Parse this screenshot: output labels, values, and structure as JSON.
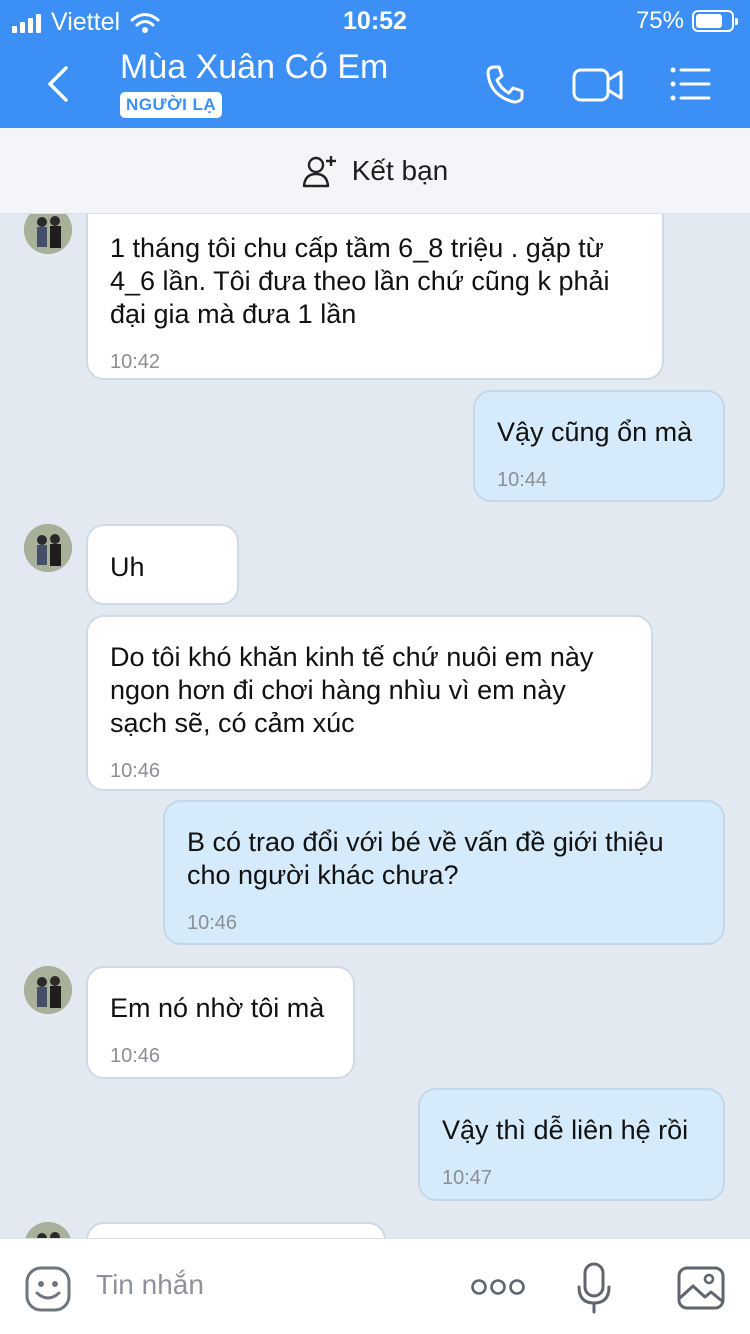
{
  "status_bar": {
    "carrier": "Viettel",
    "time": "10:52",
    "battery": "75%",
    "battery_level": 0.75
  },
  "header": {
    "title": "Mùa Xuân Có Em",
    "badge": "NGƯỜI LẠ",
    "icons": [
      "back-icon",
      "phone-icon",
      "video-call-icon",
      "menu-icon"
    ],
    "accent_color": "#3b8ff5"
  },
  "friend_bar": {
    "label": "Kết bạn",
    "icon": "add-user-icon"
  },
  "messages": [
    {
      "side": "in",
      "text": "1 tháng tôi chu cấp tầm 6_8 triệu . gặp từ\n4_6 lần. Tôi đưa theo lần chứ cũng k phải\nđại gia mà đưa 1 lần",
      "time": "10:42"
    },
    {
      "side": "out",
      "text": "Vậy cũng ổn mà",
      "time": "10:44"
    },
    {
      "side": "in",
      "text": "Uh",
      "time": ""
    },
    {
      "side": "in",
      "text": "Do tôi khó khăn kinh tế chứ nuôi em này\nngon hơn đi chơi hàng nhìu vì em này\nsạch sẽ, có cảm xúc",
      "time": "10:46"
    },
    {
      "side": "out",
      "text": "B có trao đổi với bé về vấn đề giới thiệu\ncho người khác chưa?",
      "time": "10:46"
    },
    {
      "side": "in",
      "text": "Em nó nhờ tôi mà",
      "time": "10:46"
    },
    {
      "side": "out",
      "text": "Vậy thì dễ liên hệ rồi",
      "time": "10:47"
    }
  ],
  "input_bar": {
    "placeholder": "Tin nhắn",
    "icons": [
      "emoji-icon",
      "more-icon",
      "microphone-icon",
      "image-icon"
    ]
  }
}
